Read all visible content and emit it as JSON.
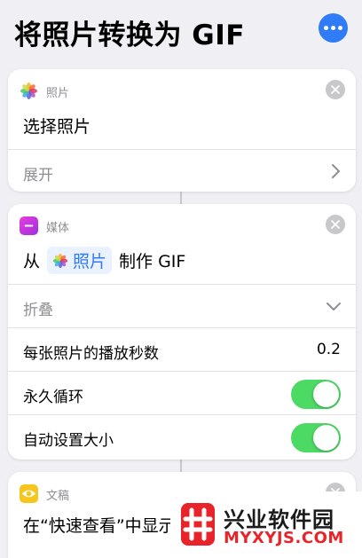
{
  "header": {
    "title": "将照片转换为 GIF",
    "more_icon": "ellipsis-icon",
    "accent": "#2f7cf6"
  },
  "actions": [
    {
      "category": "照片",
      "icon": "photos-icon",
      "main": "选择照片",
      "footer": "展开"
    },
    {
      "category": "媒体",
      "icon": "media-icon",
      "main_prefix": "从",
      "token": "照片",
      "main_suffix": "制作 GIF",
      "footer": "折叠",
      "params": [
        {
          "label": "每张照片的播放秒数",
          "value": "0.2"
        },
        {
          "label": "永久循环",
          "toggle": true
        },
        {
          "label": "自动设置大小",
          "toggle": true
        }
      ]
    },
    {
      "category": "文稿",
      "icon": "quicklook-eye-icon",
      "main": "在“快速查看”中显示"
    }
  ],
  "toggle_color": "#4cd964",
  "watermark": {
    "text": "兴业软件园",
    "url": "MYXYJS.COM",
    "color": "#e8242a"
  }
}
